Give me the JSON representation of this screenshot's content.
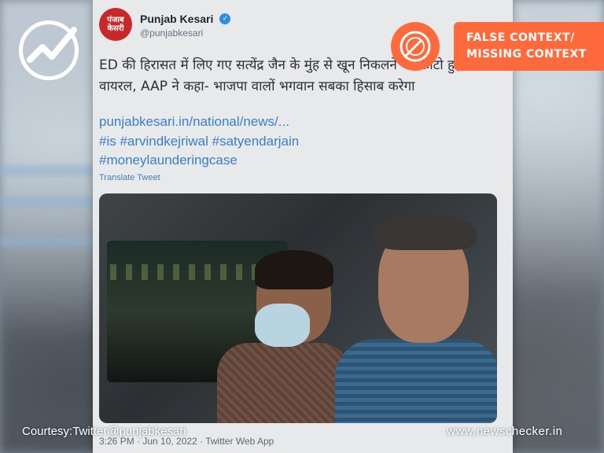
{
  "tweet": {
    "avatar_text": "पंजाब केसरी",
    "display_name": "Punjab Kesari",
    "handle": "@punjabkesari",
    "text": "ED की हिरासत में लिए गए सत्येंद्र जैन के मुंह से खून निकलने की फोटो हुई वायरल, AAP ने कहा- भाजपा वालों भगवान सबका हिसाब करेगा",
    "link": "punjabkesari.in/national/news/...",
    "hashtags_line1": "#is #arvindkejriwal #satyendarjain",
    "hashtags_line2": "#moneylaunderingcase",
    "translate": "Translate Tweet",
    "meta": "3:26 PM · Jun 10, 2022 · Twitter Web App"
  },
  "verdict": {
    "line1": "FALSE CONTEXT/",
    "line2": "MISSING CONTEXT",
    "color": "#ff6a3d"
  },
  "footer": {
    "courtesy": "Courtesy:Twitter@punjabkesari",
    "site": "www.newschecker.in"
  },
  "icons": [
    "newschecker-logo-icon",
    "verified-icon",
    "fact-check-stamp-icon"
  ]
}
